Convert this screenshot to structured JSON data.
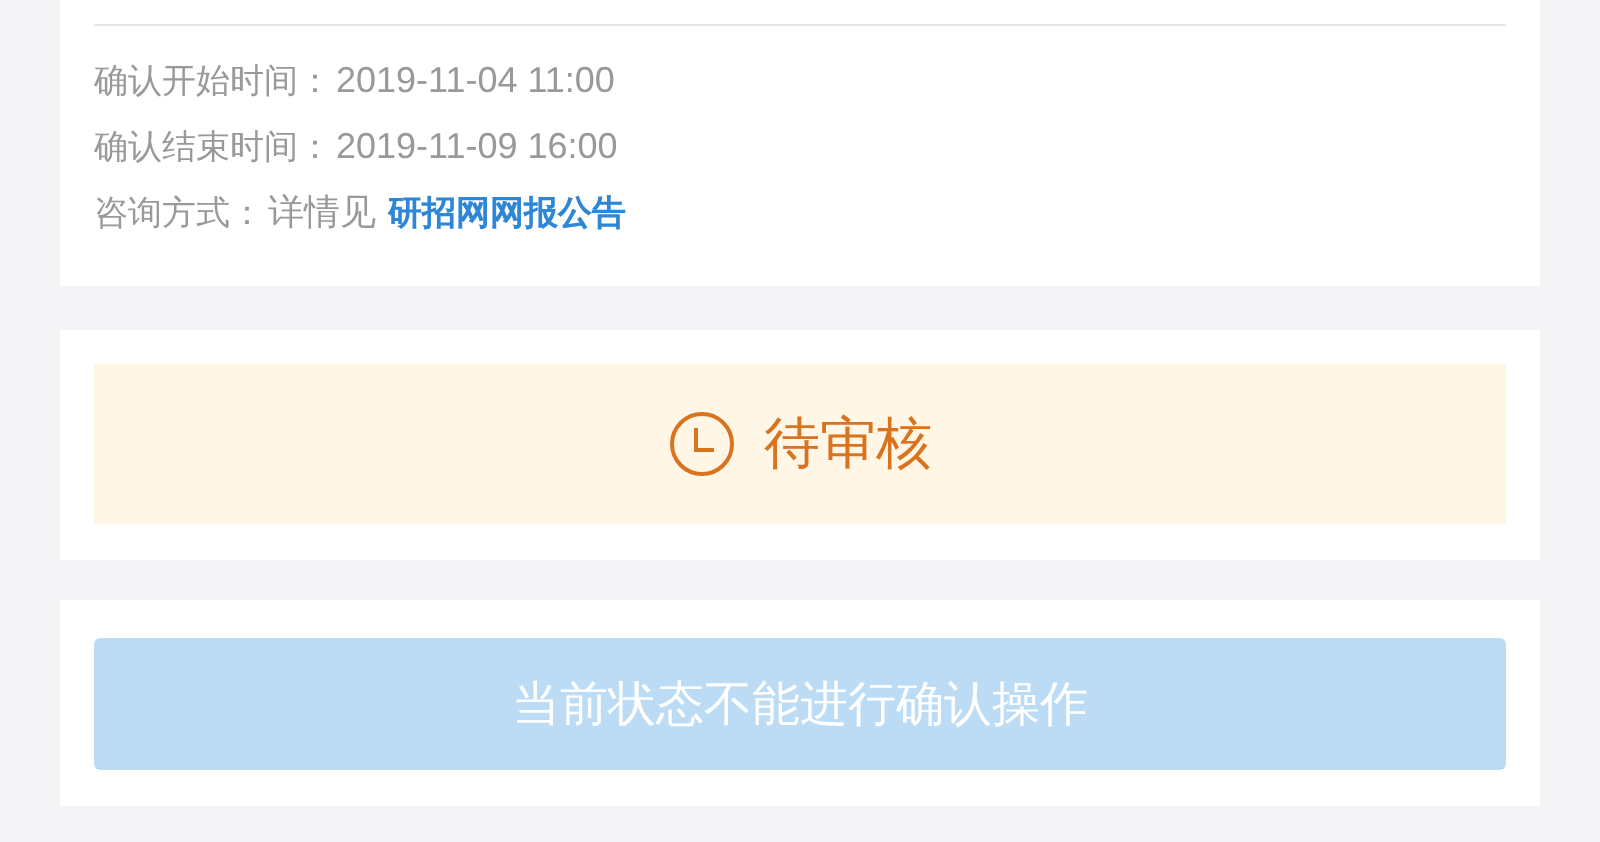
{
  "info": [
    {
      "label": "确认开始时间：",
      "value": "2019-11-04 11:00"
    },
    {
      "label": "确认结束时间：",
      "value": "2019-11-09 16:00"
    },
    {
      "label": "咨询方式：",
      "value": "详情见",
      "link": "研招网网报公告"
    }
  ],
  "status": {
    "kind": "pending",
    "text": "待审核"
  },
  "action": {
    "label": "当前状态不能进行确认操作",
    "disabled": true
  }
}
